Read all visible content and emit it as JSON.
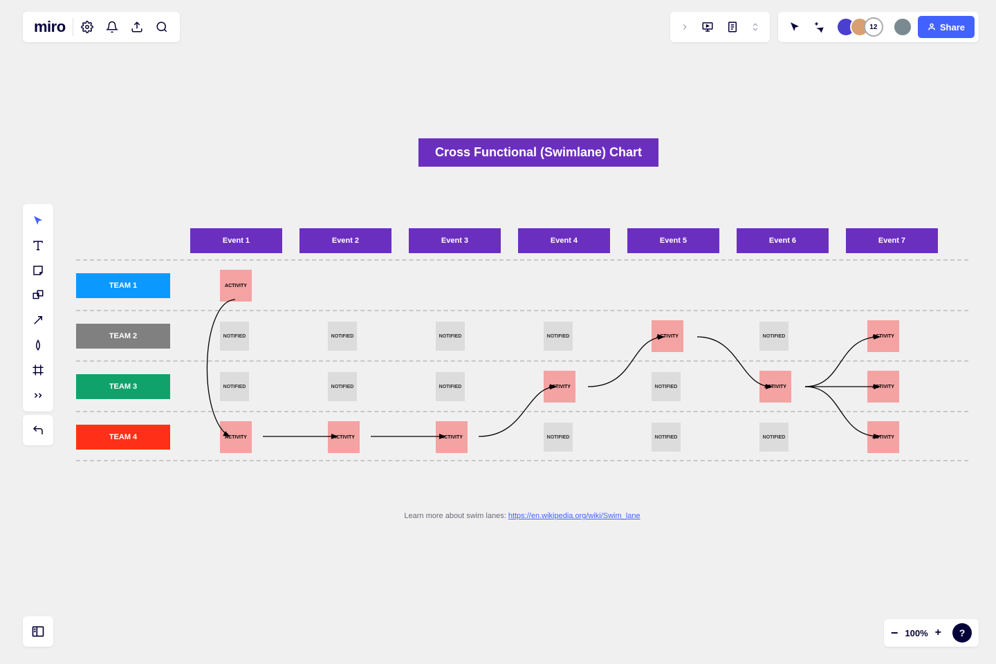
{
  "app": {
    "logo": "miro"
  },
  "topbar": {
    "zoom": "100%",
    "share_label": "Share",
    "avatar_count": "12"
  },
  "board": {
    "title": "Cross Functional (Swimlane) Chart",
    "events": [
      "Event 1",
      "Event 2",
      "Event 3",
      "Event 4",
      "Event 5",
      "Event 6",
      "Event 7"
    ],
    "teams": [
      {
        "name": "TEAM 1",
        "color": "#0c99ff"
      },
      {
        "name": "TEAM 2",
        "color": "#808080"
      },
      {
        "name": "TEAM 3",
        "color": "#0fa36b"
      },
      {
        "name": "TEAM 4",
        "color": "#ff3017"
      }
    ],
    "cells": [
      [
        {
          "t": "activity",
          "txt": "ACTIVITY"
        },
        null,
        null,
        null,
        null,
        null,
        null
      ],
      [
        {
          "t": "notified",
          "txt": "NOTIFIED"
        },
        {
          "t": "notified",
          "txt": "NOTIFIED"
        },
        {
          "t": "notified",
          "txt": "NOTIFIED"
        },
        {
          "t": "notified",
          "txt": "NOTIFIED"
        },
        {
          "t": "activity",
          "txt": "ACTIVITY"
        },
        {
          "t": "notified",
          "txt": "NOTIFIED"
        },
        {
          "t": "activity",
          "txt": "ACTIVITY"
        }
      ],
      [
        {
          "t": "notified",
          "txt": "NOTIFIED"
        },
        {
          "t": "notified",
          "txt": "NOTIFIED"
        },
        {
          "t": "notified",
          "txt": "NOTIFIED"
        },
        {
          "t": "activity",
          "txt": "ACTIVITY"
        },
        {
          "t": "notified",
          "txt": "NOTIFIED"
        },
        {
          "t": "activity",
          "txt": "ACTIVITY"
        },
        {
          "t": "activity",
          "txt": "ACTIVITY"
        }
      ],
      [
        {
          "t": "activity",
          "txt": "ACTIVITY"
        },
        {
          "t": "activity",
          "txt": "ACTIVITY"
        },
        {
          "t": "activity",
          "txt": "ACTIVITY"
        },
        {
          "t": "notified",
          "txt": "NOTIFIED"
        },
        {
          "t": "notified",
          "txt": "NOTIFIED"
        },
        {
          "t": "notified",
          "txt": "NOTIFIED"
        },
        {
          "t": "activity",
          "txt": "ACTIVITY"
        }
      ]
    ],
    "footer_text": "Learn more about swim lanes: ",
    "footer_url": "https://en.wikipedia.org/wiki/Swim_lane"
  }
}
